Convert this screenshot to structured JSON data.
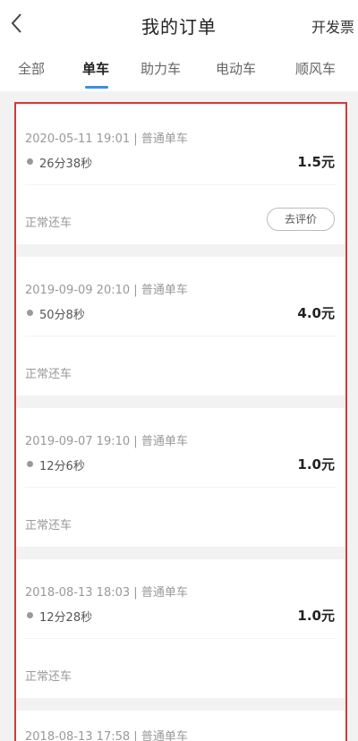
{
  "header": {
    "title": "我的订单",
    "invoice_label": "开发票"
  },
  "tabs": [
    {
      "label": "全部",
      "active": false
    },
    {
      "label": "单车",
      "active": true
    },
    {
      "label": "助力车",
      "active": false
    },
    {
      "label": "电动车",
      "active": false
    },
    {
      "label": "顺风车",
      "active": false
    }
  ],
  "colors": {
    "accent": "#3a8ee6",
    "highlight_frame": "#d23a3a"
  },
  "orders": [
    {
      "datetime": "2020-05-11 19:01",
      "type": "普通单车",
      "duration": "26分38秒",
      "price": "1.5元",
      "status": "正常还车",
      "action": "去评价"
    },
    {
      "datetime": "2019-09-09 20:10",
      "type": "普通单车",
      "duration": "50分8秒",
      "price": "4.0元",
      "status": "正常还车"
    },
    {
      "datetime": "2019-09-07 19:10",
      "type": "普通单车",
      "duration": "12分6秒",
      "price": "1.0元",
      "status": "正常还车"
    },
    {
      "datetime": "2018-08-13 18:03",
      "type": "普通单车",
      "duration": "12分28秒",
      "price": "1.0元",
      "status": "正常还车"
    },
    {
      "datetime": "2018-08-13 17:58",
      "type": "普通单车"
    }
  ]
}
